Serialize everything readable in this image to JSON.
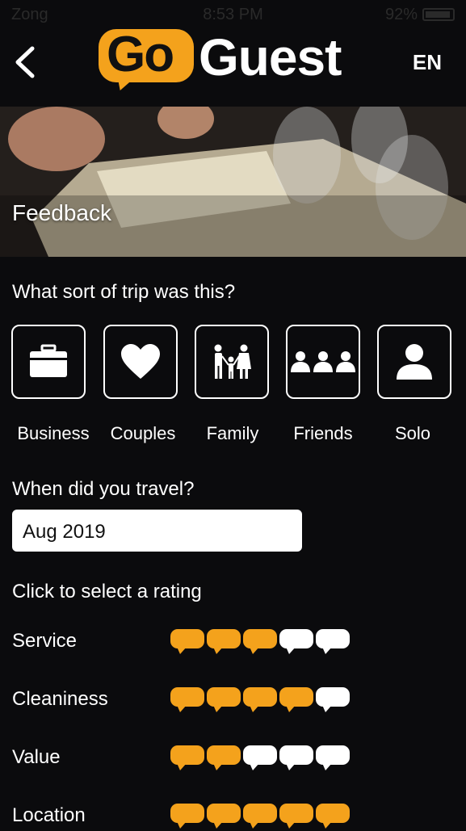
{
  "status_bar": {
    "carrier": "Zong",
    "time": "8:53 PM",
    "battery": "92%"
  },
  "header": {
    "logo_go": "Go",
    "logo_guest": "Guest",
    "language": "EN",
    "brand_color": "#f4a21c"
  },
  "hero": {
    "title": "Feedback"
  },
  "trip": {
    "question": "What sort of trip was this?",
    "options": [
      {
        "label": "Business",
        "icon": "briefcase-icon"
      },
      {
        "label": "Couples",
        "icon": "heart-icon"
      },
      {
        "label": "Family",
        "icon": "family-icon"
      },
      {
        "label": "Friends",
        "icon": "friends-icon"
      },
      {
        "label": "Solo",
        "icon": "person-icon"
      }
    ]
  },
  "travel_date": {
    "question": "When did you travel?",
    "value": "Aug 2019"
  },
  "ratings": {
    "prompt": "Click to select a rating",
    "max": 5,
    "active_color": "#f4a21c",
    "inactive_color": "#ffffff",
    "items": [
      {
        "label": "Service",
        "value": 3
      },
      {
        "label": "Cleaniness",
        "value": 4
      },
      {
        "label": "Value",
        "value": 2
      },
      {
        "label": "Location",
        "value": 5
      }
    ]
  }
}
